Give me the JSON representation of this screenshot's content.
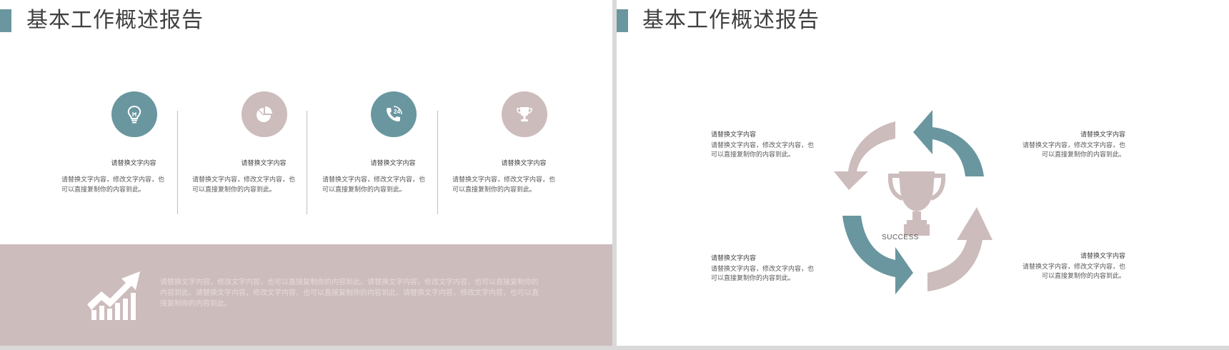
{
  "colors": {
    "teal": "#6a969f",
    "rose": "#cdbcbc",
    "title_bar": "#6a969f"
  },
  "left_slide": {
    "title": "基本工作概述报告",
    "features": [
      {
        "icon": "lightbulb-icon",
        "color": "#6a969f",
        "label": "请替换文字内容",
        "desc": "请替换文字内容，修改文字内容，也可以直接复制你的内容到此。"
      },
      {
        "icon": "pie-chart-icon",
        "color": "#cdbcbc",
        "label": "请替换文字内容",
        "desc": "请替换文字内容，修改文字内容，也可以直接复制你的内容到此。"
      },
      {
        "icon": "phone-24-icon",
        "color": "#6a969f",
        "label": "请替换文字内容",
        "desc": "请替换文字内容，修改文字内容，也可以直接复制你的内容到此。"
      },
      {
        "icon": "trophy-icon",
        "color": "#cdbcbc",
        "label": "请替换文字内容",
        "desc": "请替换文字内容，修改文字内容，也可以直接复制你的内容到此。"
      }
    ],
    "band": {
      "icon": "growth-chart-icon",
      "text": "请替换文字内容，修改文字内容，也可以直接复制你的内容到此。请替换文字内容，修改文字内容，也可以直接复制你的内容到此。请替换文字内容，修改文字内容，也可以直接复制你的内容到此。请替换文字内容，修改文字内容，也可以直接复制你的内容到此。"
    }
  },
  "right_slide": {
    "title": "基本工作概述报告",
    "center_icon": "trophy-icon",
    "center_label": "SUCCESS",
    "blocks": {
      "top_left": {
        "heading": "请替换文字内容",
        "body": "请替换文字内容，修改文字内容，也可以直接复制你的内容到此。"
      },
      "top_right": {
        "heading": "请替换文字内容",
        "body": "请替换文字内容，修改文字内容，也可以直接复制你的内容到此。"
      },
      "bottom_left": {
        "heading": "请替换文字内容",
        "body": "请替换文字内容，修改文字内容，也可以直接复制你的内容到此。"
      },
      "bottom_right": {
        "heading": "请替换文字内容",
        "body": "请替换文字内容，修改文字内容，也可以直接复制你的内容到此。"
      }
    }
  }
}
